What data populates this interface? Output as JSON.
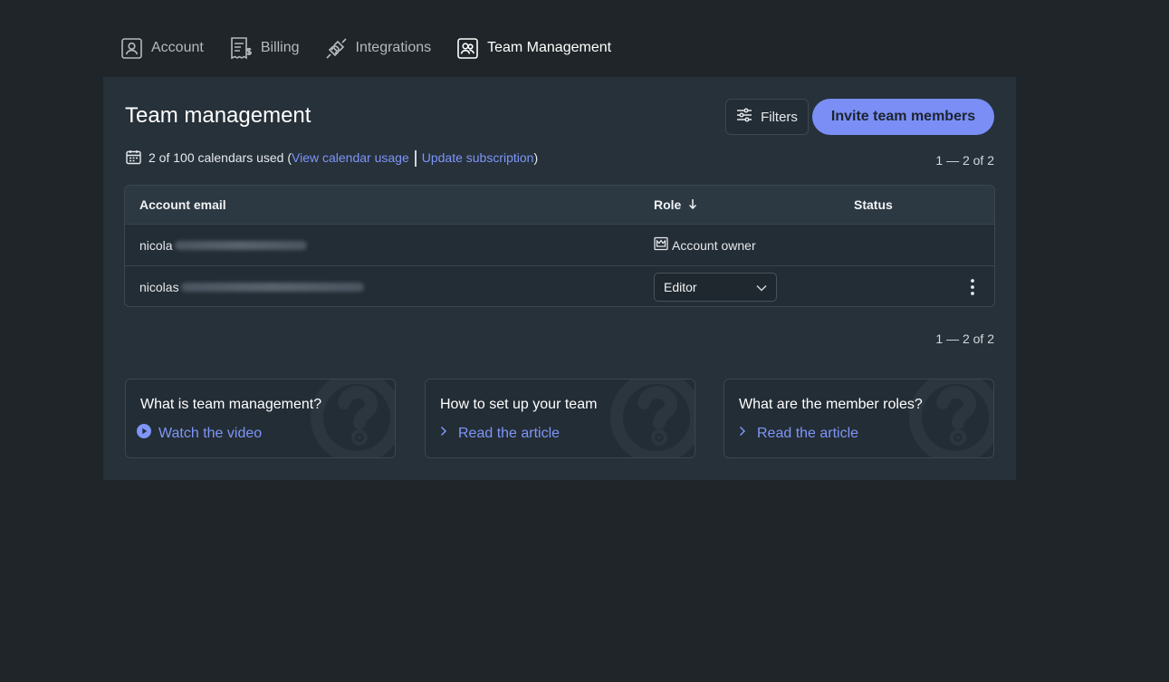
{
  "tabs": [
    {
      "label": "Account",
      "icon": "account-icon"
    },
    {
      "label": "Billing",
      "icon": "billing-icon"
    },
    {
      "label": "Integrations",
      "icon": "integrations-icon"
    },
    {
      "label": "Team Management",
      "icon": "team-icon",
      "active": true
    }
  ],
  "header": {
    "title": "Team management",
    "filters_label": "Filters",
    "invite_label": "Invite team members"
  },
  "usage": {
    "text": "2 of 100 calendars used",
    "open_paren": "(",
    "view_link": "View calendar usage",
    "update_link": "Update subscription",
    "close_paren": ")"
  },
  "pager": {
    "top": "1 — 2 of 2",
    "bottom": "1 — 2 of 2"
  },
  "table": {
    "columns": {
      "email": "Account email",
      "role": "Role",
      "status": "Status"
    },
    "rows": [
      {
        "email_prefix": "nicola",
        "role": "Account owner"
      },
      {
        "email_prefix": "nicolas",
        "role": "Editor"
      }
    ]
  },
  "cards": [
    {
      "title": "What is team management?",
      "link": "Watch the video",
      "link_icon": "play-icon"
    },
    {
      "title": "How to set up your team",
      "link": "Read the article",
      "link_icon": "chevron-right-icon"
    },
    {
      "title": "What are the member roles?",
      "link": "Read the article",
      "link_icon": "chevron-right-icon"
    }
  ],
  "colors": {
    "accent": "#7a8ef5",
    "link": "#7f95f7",
    "background": "#1f2528",
    "panel": "#26313a"
  }
}
